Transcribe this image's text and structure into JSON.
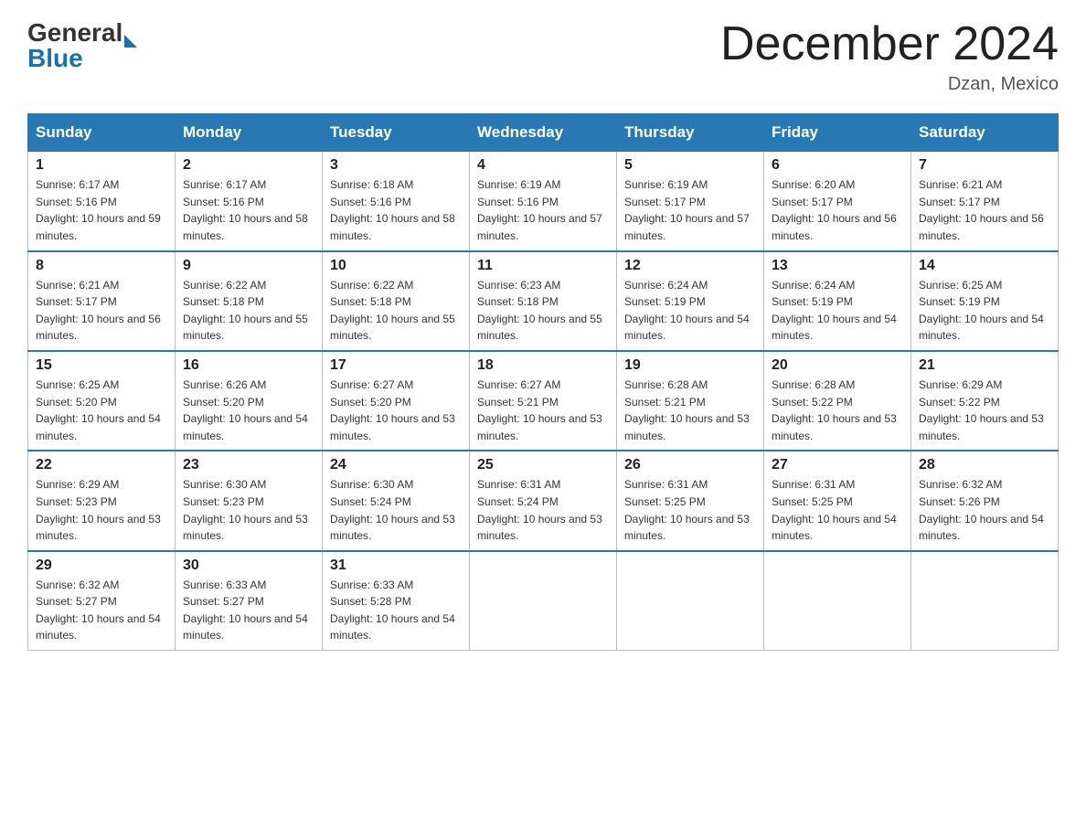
{
  "header": {
    "logo_general": "General",
    "logo_blue": "Blue",
    "month_title": "December 2024",
    "location": "Dzan, Mexico"
  },
  "days_of_week": [
    "Sunday",
    "Monday",
    "Tuesday",
    "Wednesday",
    "Thursday",
    "Friday",
    "Saturday"
  ],
  "weeks": [
    [
      {
        "day": "1",
        "sunrise": "6:17 AM",
        "sunset": "5:16 PM",
        "daylight": "10 hours and 59 minutes."
      },
      {
        "day": "2",
        "sunrise": "6:17 AM",
        "sunset": "5:16 PM",
        "daylight": "10 hours and 58 minutes."
      },
      {
        "day": "3",
        "sunrise": "6:18 AM",
        "sunset": "5:16 PM",
        "daylight": "10 hours and 58 minutes."
      },
      {
        "day": "4",
        "sunrise": "6:19 AM",
        "sunset": "5:16 PM",
        "daylight": "10 hours and 57 minutes."
      },
      {
        "day": "5",
        "sunrise": "6:19 AM",
        "sunset": "5:17 PM",
        "daylight": "10 hours and 57 minutes."
      },
      {
        "day": "6",
        "sunrise": "6:20 AM",
        "sunset": "5:17 PM",
        "daylight": "10 hours and 56 minutes."
      },
      {
        "day": "7",
        "sunrise": "6:21 AM",
        "sunset": "5:17 PM",
        "daylight": "10 hours and 56 minutes."
      }
    ],
    [
      {
        "day": "8",
        "sunrise": "6:21 AM",
        "sunset": "5:17 PM",
        "daylight": "10 hours and 56 minutes."
      },
      {
        "day": "9",
        "sunrise": "6:22 AM",
        "sunset": "5:18 PM",
        "daylight": "10 hours and 55 minutes."
      },
      {
        "day": "10",
        "sunrise": "6:22 AM",
        "sunset": "5:18 PM",
        "daylight": "10 hours and 55 minutes."
      },
      {
        "day": "11",
        "sunrise": "6:23 AM",
        "sunset": "5:18 PM",
        "daylight": "10 hours and 55 minutes."
      },
      {
        "day": "12",
        "sunrise": "6:24 AM",
        "sunset": "5:19 PM",
        "daylight": "10 hours and 54 minutes."
      },
      {
        "day": "13",
        "sunrise": "6:24 AM",
        "sunset": "5:19 PM",
        "daylight": "10 hours and 54 minutes."
      },
      {
        "day": "14",
        "sunrise": "6:25 AM",
        "sunset": "5:19 PM",
        "daylight": "10 hours and 54 minutes."
      }
    ],
    [
      {
        "day": "15",
        "sunrise": "6:25 AM",
        "sunset": "5:20 PM",
        "daylight": "10 hours and 54 minutes."
      },
      {
        "day": "16",
        "sunrise": "6:26 AM",
        "sunset": "5:20 PM",
        "daylight": "10 hours and 54 minutes."
      },
      {
        "day": "17",
        "sunrise": "6:27 AM",
        "sunset": "5:20 PM",
        "daylight": "10 hours and 53 minutes."
      },
      {
        "day": "18",
        "sunrise": "6:27 AM",
        "sunset": "5:21 PM",
        "daylight": "10 hours and 53 minutes."
      },
      {
        "day": "19",
        "sunrise": "6:28 AM",
        "sunset": "5:21 PM",
        "daylight": "10 hours and 53 minutes."
      },
      {
        "day": "20",
        "sunrise": "6:28 AM",
        "sunset": "5:22 PM",
        "daylight": "10 hours and 53 minutes."
      },
      {
        "day": "21",
        "sunrise": "6:29 AM",
        "sunset": "5:22 PM",
        "daylight": "10 hours and 53 minutes."
      }
    ],
    [
      {
        "day": "22",
        "sunrise": "6:29 AM",
        "sunset": "5:23 PM",
        "daylight": "10 hours and 53 minutes."
      },
      {
        "day": "23",
        "sunrise": "6:30 AM",
        "sunset": "5:23 PM",
        "daylight": "10 hours and 53 minutes."
      },
      {
        "day": "24",
        "sunrise": "6:30 AM",
        "sunset": "5:24 PM",
        "daylight": "10 hours and 53 minutes."
      },
      {
        "day": "25",
        "sunrise": "6:31 AM",
        "sunset": "5:24 PM",
        "daylight": "10 hours and 53 minutes."
      },
      {
        "day": "26",
        "sunrise": "6:31 AM",
        "sunset": "5:25 PM",
        "daylight": "10 hours and 53 minutes."
      },
      {
        "day": "27",
        "sunrise": "6:31 AM",
        "sunset": "5:25 PM",
        "daylight": "10 hours and 54 minutes."
      },
      {
        "day": "28",
        "sunrise": "6:32 AM",
        "sunset": "5:26 PM",
        "daylight": "10 hours and 54 minutes."
      }
    ],
    [
      {
        "day": "29",
        "sunrise": "6:32 AM",
        "sunset": "5:27 PM",
        "daylight": "10 hours and 54 minutes."
      },
      {
        "day": "30",
        "sunrise": "6:33 AM",
        "sunset": "5:27 PM",
        "daylight": "10 hours and 54 minutes."
      },
      {
        "day": "31",
        "sunrise": "6:33 AM",
        "sunset": "5:28 PM",
        "daylight": "10 hours and 54 minutes."
      },
      null,
      null,
      null,
      null
    ]
  ]
}
